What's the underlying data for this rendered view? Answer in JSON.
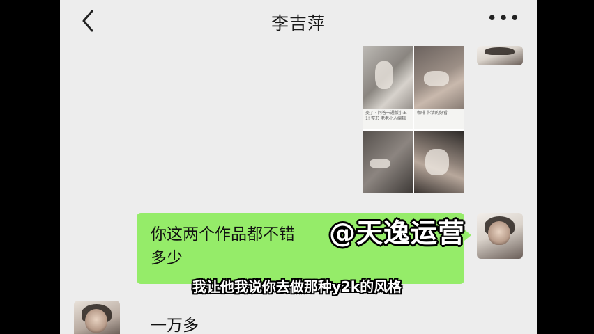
{
  "chat": {
    "title": "李吉萍",
    "back_icon": "chevron-left-icon",
    "more_label": "•••"
  },
  "images": {
    "captions": [
      "麦了 · 问答卡通版小玉 1! 整形 老老小人编辑",
      "咖啡 你请的好看"
    ]
  },
  "messages": {
    "outgoing_text": "你这两个作品都不错",
    "outgoing_text_line2": "多少",
    "incoming_text": "一万多"
  },
  "overlay": {
    "watermark": "@天逸运营",
    "subtitle": "我让他我说你去做那种y2k的风格"
  },
  "colors": {
    "chat_bg": "#ededed",
    "bubble_green": "#95ec69"
  }
}
